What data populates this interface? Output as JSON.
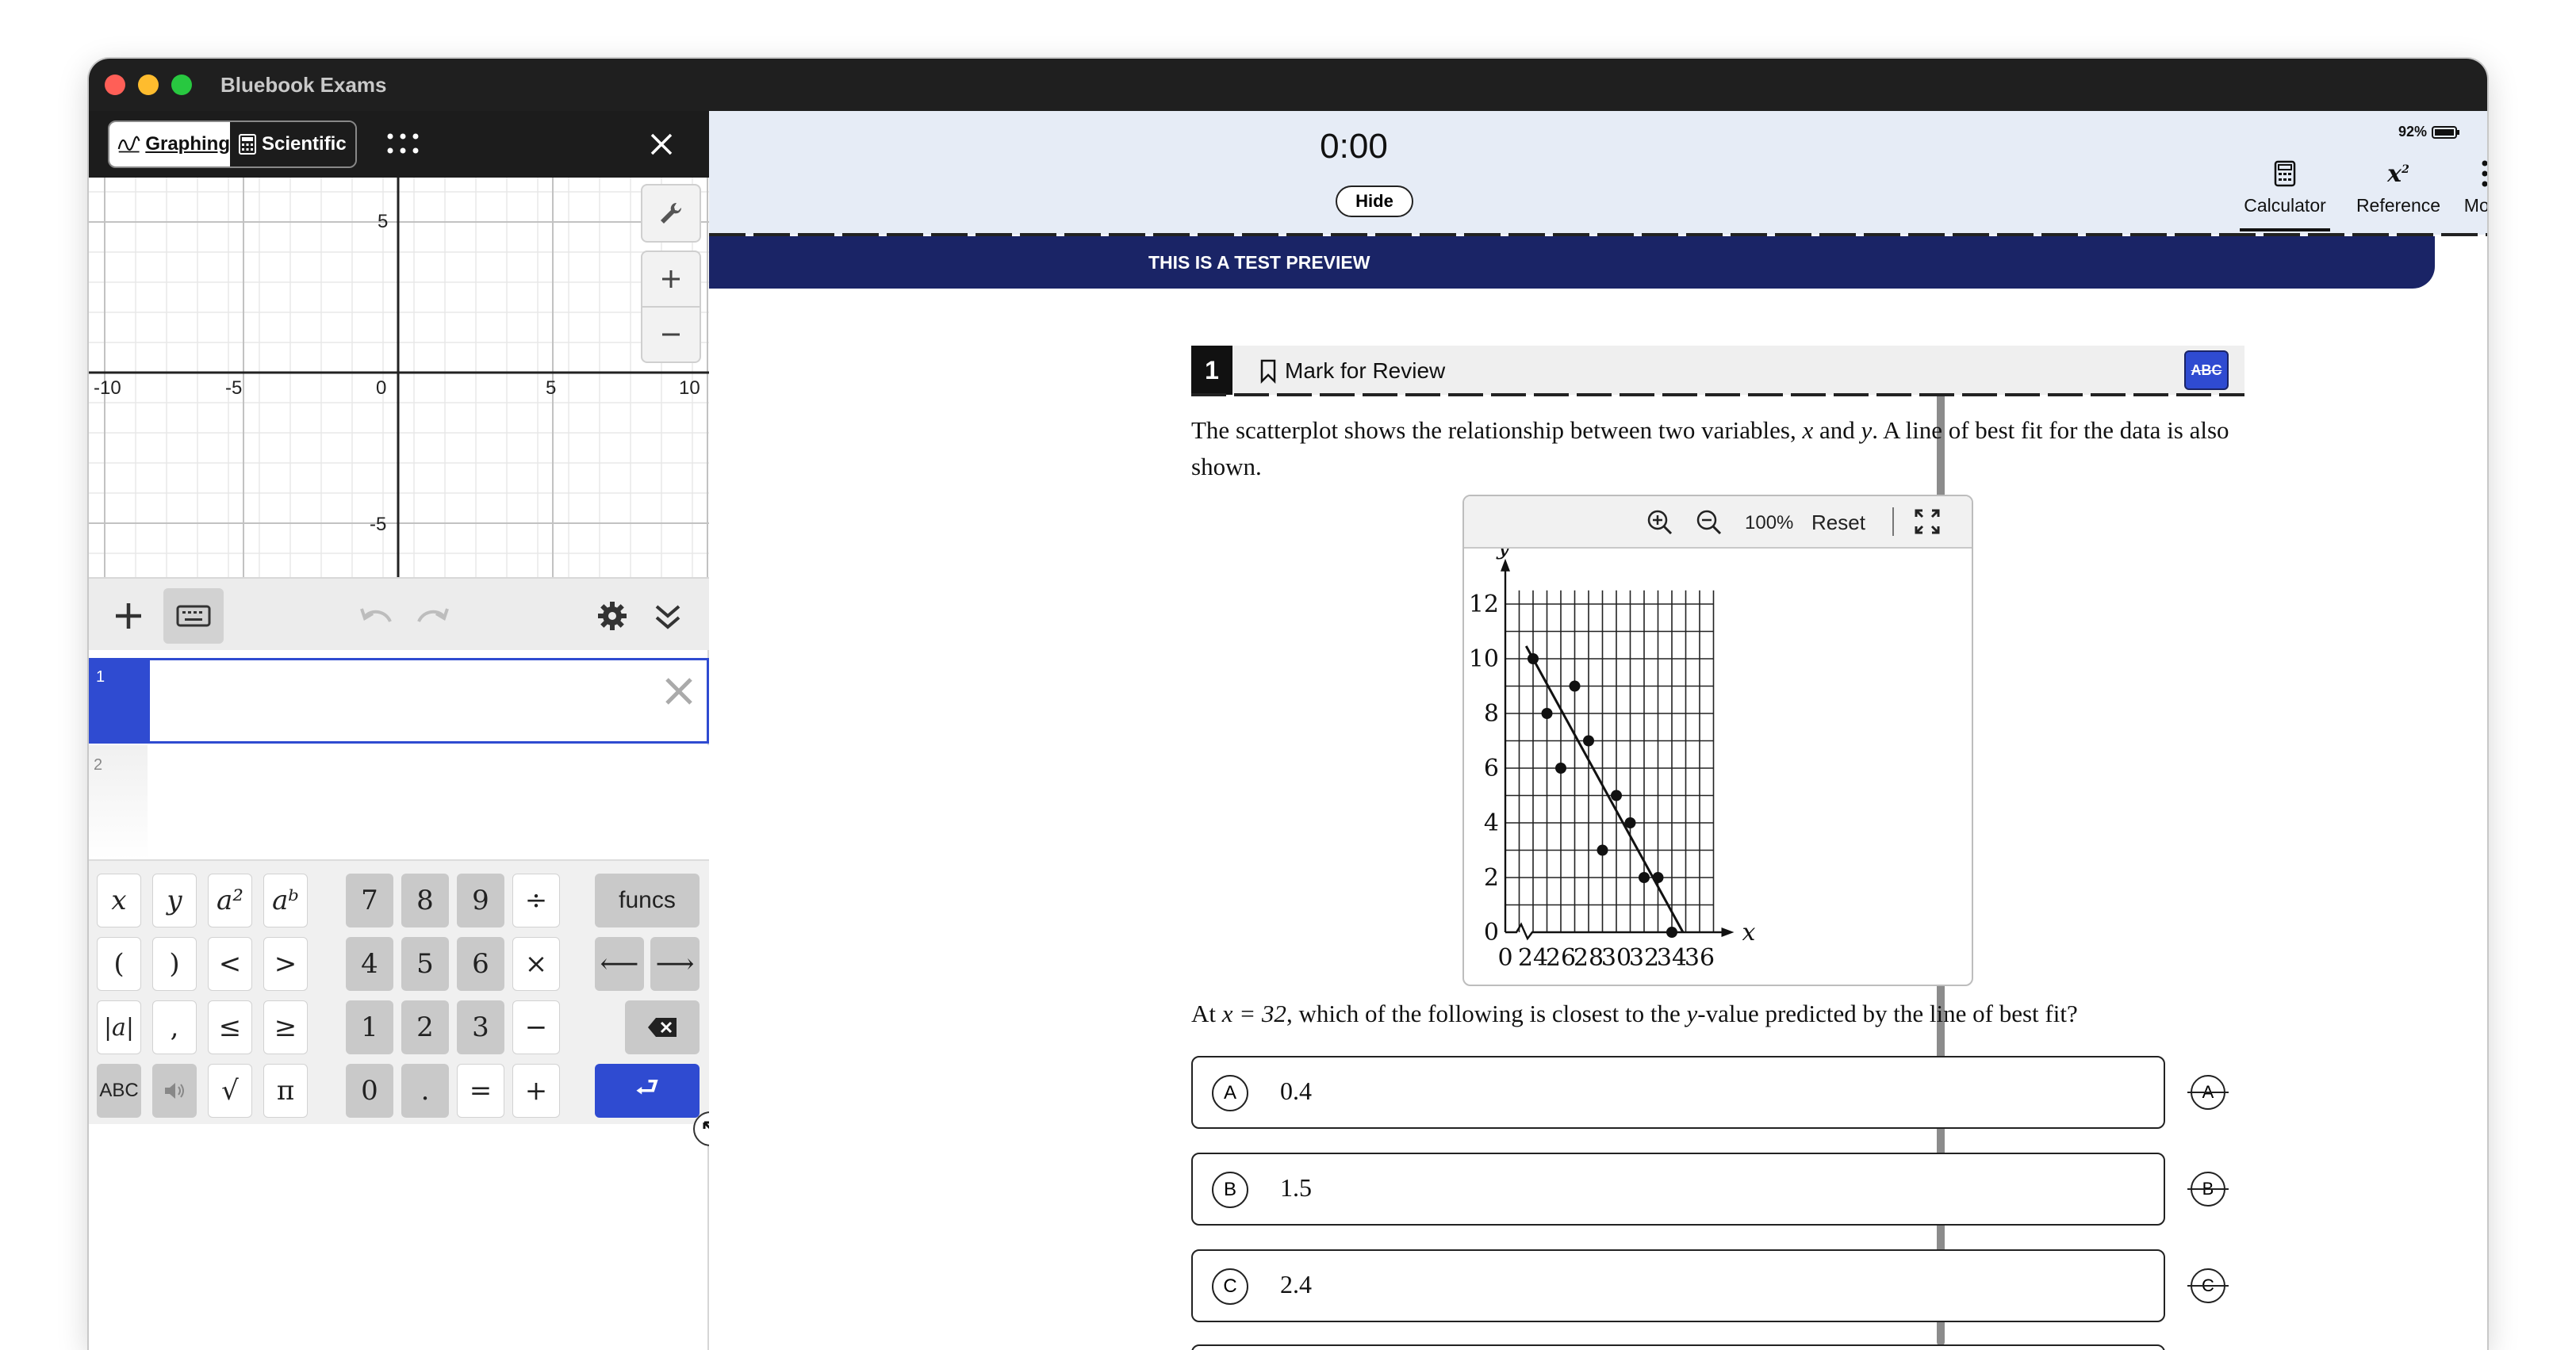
{
  "window": {
    "title": "Bluebook Exams"
  },
  "calculator": {
    "modes": {
      "graphing": "Graphing",
      "scientific": "Scientific"
    },
    "graph_axis_labels": {
      "x_neg10": "-10",
      "x_neg5": "-5",
      "x_0": "0",
      "x_5": "5",
      "x_10": "10",
      "y_5": "5",
      "y_neg5": "-5"
    },
    "expressions": [
      {
        "index": "1",
        "value": ""
      },
      {
        "index": "2",
        "value": ""
      }
    ],
    "keys": {
      "x": "x",
      "y": "y",
      "a2": "a²",
      "ab": "aᵇ",
      "open": "(",
      "close": ")",
      "lt": "<",
      "gt": ">",
      "abs": "|a|",
      "comma": ",",
      "le": "≤",
      "ge": "≥",
      "abc": "ABC",
      "sqrt": "√",
      "pi": "π",
      "k7": "7",
      "k8": "8",
      "k9": "9",
      "div": "÷",
      "k4": "4",
      "k5": "5",
      "k6": "6",
      "mul": "×",
      "k1": "1",
      "k2": "2",
      "k3": "3",
      "minus": "−",
      "k0": "0",
      "dot": ".",
      "eq": "=",
      "plus": "+",
      "funcs": "funcs",
      "left": "⟵",
      "right": "⟶",
      "enter": "⮐"
    }
  },
  "header": {
    "timer": "0:00",
    "hide_label": "Hide",
    "battery": "92%",
    "tools": [
      {
        "label": "Calculator"
      },
      {
        "label": "Reference"
      },
      {
        "label": "More"
      }
    ],
    "banner": "THIS IS A TEST PREVIEW"
  },
  "question": {
    "number": "1",
    "mark_label": "Mark for Review",
    "abc_label": "ABC",
    "stem_part1": "The scatterplot shows the relationship between two variables,",
    "stem_x": "x",
    "stem_and": "and",
    "stem_y": "y",
    "stem_part2": ". A line of best fit for the data is also shown.",
    "prompt_at": "At",
    "prompt_eq": "x = 32",
    "prompt_rest1": ", which of the following is closest to the",
    "prompt_y": "y",
    "prompt_rest2": "-value predicted by the line of best fit?",
    "choices": [
      {
        "letter": "A",
        "value": "0.4"
      },
      {
        "letter": "B",
        "value": "1.5"
      },
      {
        "letter": "C",
        "value": "2.4"
      }
    ]
  },
  "figure_toolbar": {
    "zoom": "100%",
    "reset": "Reset"
  },
  "chart_data": {
    "type": "scatter",
    "xlabel": "x",
    "ylabel": "y",
    "x_ticks": [
      0,
      24,
      26,
      28,
      30,
      32,
      34,
      36
    ],
    "y_ticks": [
      0,
      2,
      4,
      6,
      8,
      10,
      12
    ],
    "xlim": [
      22,
      37
    ],
    "ylim": [
      0,
      12.5
    ],
    "axis_break": true,
    "grid": true,
    "points": [
      [
        24,
        10
      ],
      [
        25,
        8
      ],
      [
        26,
        6
      ],
      [
        27,
        9
      ],
      [
        28,
        7
      ],
      [
        29,
        3
      ],
      [
        30,
        5
      ],
      [
        31,
        4
      ],
      [
        32,
        2
      ],
      [
        33,
        2
      ],
      [
        34,
        0
      ]
    ],
    "best_fit_line": {
      "from": [
        24,
        10
      ],
      "to": [
        34.8,
        0
      ]
    }
  }
}
